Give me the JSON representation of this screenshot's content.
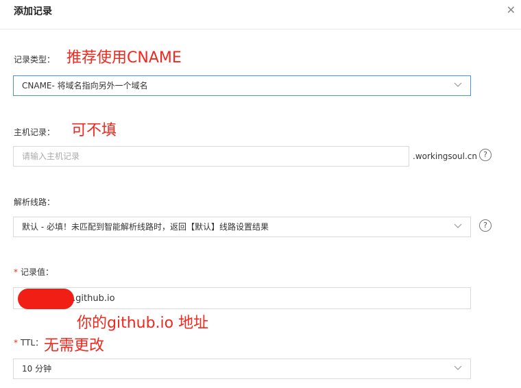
{
  "dialog": {
    "title": "添加记录",
    "close_icon": "close-icon",
    "close_glyph": "✕"
  },
  "form": {
    "record_type": {
      "label": "记录类型：",
      "selected": "CNAME- 将域名指向另外一个域名"
    },
    "host": {
      "label": "主机记录：",
      "placeholder": "请输入主机记录",
      "suffix": ".workingsoul.cn",
      "help_glyph": "?"
    },
    "line": {
      "label": "解析线路：",
      "selected": "默认 - 必填！未匹配到智能解析线路时，返回【默认】线路设置结果",
      "help_glyph": "?"
    },
    "value": {
      "required_mark": "*",
      "label": "记录值：",
      "visible_value": ".github.io"
    },
    "ttl": {
      "required_mark": "*",
      "label": "TTL：",
      "selected": "10 分钟"
    }
  },
  "annotations": {
    "record_type_note": "推荐使用CNAME",
    "host_note": "可不填",
    "value_note": "你的github.io 地址",
    "ttl_note": "无需更改"
  },
  "colors": {
    "annotation": "#f0281e",
    "focus_border": "#4a90e2",
    "required": "#e0341c"
  }
}
